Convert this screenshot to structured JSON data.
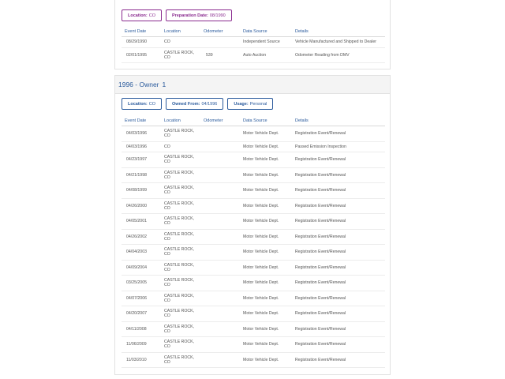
{
  "columns": [
    "Event Date",
    "Location",
    "Odometer",
    "Data Source",
    "Details"
  ],
  "section1": {
    "pills": [
      {
        "label": "Location:",
        "value": "CO"
      },
      {
        "label": "Preparation Date:",
        "value": "08/1990"
      }
    ],
    "rows": [
      {
        "date": "08/29/1990",
        "location": "CO",
        "odometer": "",
        "source": "Independent Source",
        "details": "Vehicle Manufactured and Shipped to Dealer"
      },
      {
        "date": "02/01/1995",
        "location": "CASTLE ROCK, CO",
        "odometer": "539",
        "source": "Auto Auction",
        "details": "Odometer Reading from DMV"
      }
    ]
  },
  "section2": {
    "header": {
      "title": "1996 - Owner",
      "number": "1"
    },
    "pills": [
      {
        "label": "Location:",
        "value": "CO"
      },
      {
        "label": "Owned From:",
        "value": "04/1996"
      },
      {
        "label": "Usage:",
        "value": "Personal"
      }
    ],
    "rows": [
      {
        "date": "04/03/1996",
        "location": "CASTLE ROCK, CO",
        "odometer": "",
        "source": "Motor Vehicle Dept.",
        "details": "Registration Event/Renewal"
      },
      {
        "date": "04/03/1996",
        "location": "CO",
        "odometer": "",
        "source": "Motor Vehicle Dept.",
        "details": "Passed Emission Inspection"
      },
      {
        "date": "04/23/1997",
        "location": "CASTLE ROCK, CO",
        "odometer": "",
        "source": "Motor Vehicle Dept.",
        "details": "Registration Event/Renewal"
      },
      {
        "date": "04/21/1998",
        "location": "CASTLE ROCK, CO",
        "odometer": "",
        "source": "Motor Vehicle Dept.",
        "details": "Registration Event/Renewal"
      },
      {
        "date": "04/08/1999",
        "location": "CASTLE ROCK, CO",
        "odometer": "",
        "source": "Motor Vehicle Dept.",
        "details": "Registration Event/Renewal"
      },
      {
        "date": "04/26/2000",
        "location": "CASTLE ROCK, CO",
        "odometer": "",
        "source": "Motor Vehicle Dept.",
        "details": "Registration Event/Renewal"
      },
      {
        "date": "04/05/2001",
        "location": "CASTLE ROCK, CO",
        "odometer": "",
        "source": "Motor Vehicle Dept.",
        "details": "Registration Event/Renewal"
      },
      {
        "date": "04/26/2002",
        "location": "CASTLE ROCK, CO",
        "odometer": "",
        "source": "Motor Vehicle Dept.",
        "details": "Registration Event/Renewal"
      },
      {
        "date": "04/04/2003",
        "location": "CASTLE ROCK, CO",
        "odometer": "",
        "source": "Motor Vehicle Dept.",
        "details": "Registration Event/Renewal"
      },
      {
        "date": "04/09/2004",
        "location": "CASTLE ROCK, CO",
        "odometer": "",
        "source": "Motor Vehicle Dept.",
        "details": "Registration Event/Renewal"
      },
      {
        "date": "03/25/2005",
        "location": "CASTLE ROCK, CO",
        "odometer": "",
        "source": "Motor Vehicle Dept.",
        "details": "Registration Event/Renewal"
      },
      {
        "date": "04/07/2006",
        "location": "CASTLE ROCK, CO",
        "odometer": "",
        "source": "Motor Vehicle Dept.",
        "details": "Registration Event/Renewal"
      },
      {
        "date": "04/20/2007",
        "location": "CASTLE ROCK, CO",
        "odometer": "",
        "source": "Motor Vehicle Dept.",
        "details": "Registration Event/Renewal"
      },
      {
        "date": "04/11/2008",
        "location": "CASTLE ROCK, CO",
        "odometer": "",
        "source": "Motor Vehicle Dept.",
        "details": "Registration Event/Renewal"
      },
      {
        "date": "11/06/2009",
        "location": "CASTLE ROCK, CO",
        "odometer": "",
        "source": "Motor Vehicle Dept.",
        "details": "Registration Event/Renewal"
      },
      {
        "date": "11/03/2010",
        "location": "CASTLE ROCK, CO",
        "odometer": "",
        "source": "Motor Vehicle Dept.",
        "details": "Registration Event/Renewal"
      }
    ]
  },
  "colors": {
    "accent_blue": "#2a5a9c",
    "accent_purple": "#8a2b8f"
  }
}
